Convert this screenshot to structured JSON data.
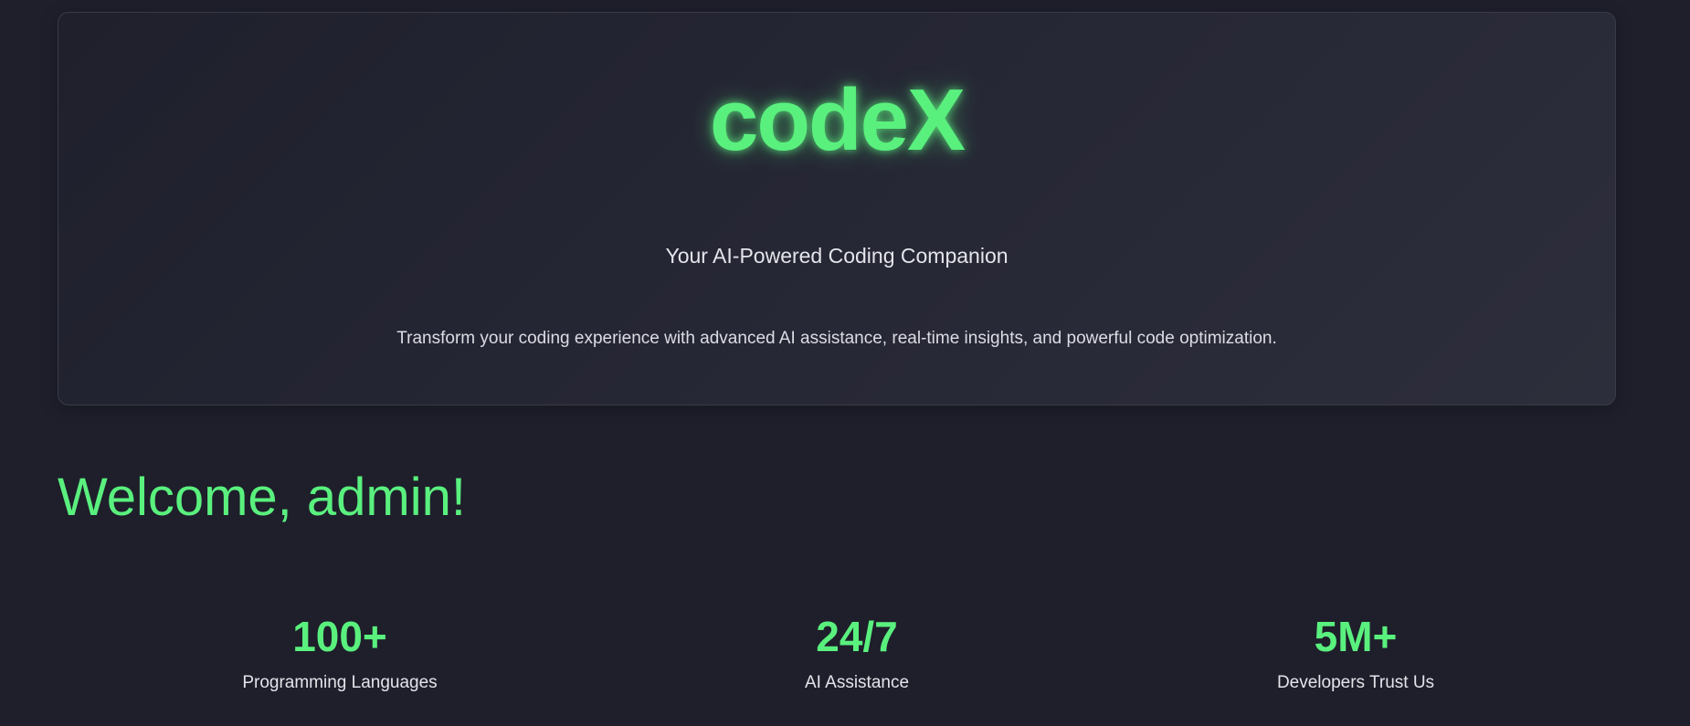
{
  "hero": {
    "logo": "codeX",
    "tagline": "Your AI-Powered Coding Companion",
    "description": "Transform your coding experience with advanced AI assistance, real-time insights, and powerful code optimization."
  },
  "welcome": {
    "text": "Welcome, admin!"
  },
  "stats": [
    {
      "value": "100+",
      "label": "Programming Languages"
    },
    {
      "value": "24/7",
      "label": "AI Assistance"
    },
    {
      "value": "5M+",
      "label": "Developers Trust Us"
    }
  ],
  "colors": {
    "accent": "#5af07e",
    "background": "#1e1f2b",
    "card_border": "#3a3b48",
    "text": "#e4e4ea"
  }
}
